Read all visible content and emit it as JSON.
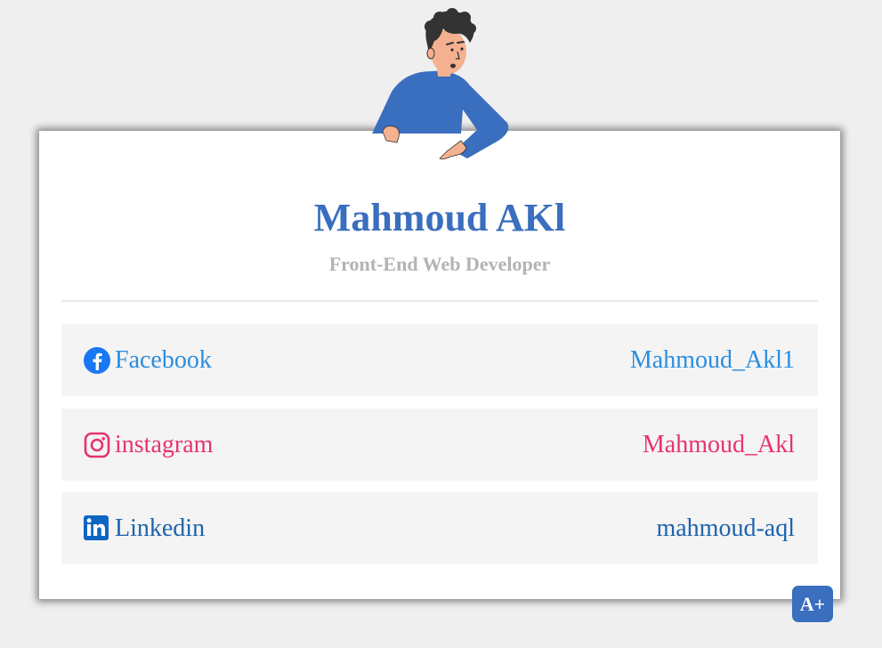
{
  "profile": {
    "name": "Mahmoud AKl",
    "title": "Front-End Web Developer"
  },
  "links": [
    {
      "platform": "Facebook",
      "handle": "Mahmoud_Akl1",
      "icon": "facebook-icon",
      "color": "#2a8ee0"
    },
    {
      "platform": "instagram",
      "handle": "Mahmoud_Akl",
      "icon": "instagram-icon",
      "color": "#e73370"
    },
    {
      "platform": "Linkedin",
      "handle": "mahmoud-aql",
      "icon": "linkedin-icon",
      "color": "#1e63ad"
    }
  ],
  "badge": {
    "label": "A+"
  },
  "colors": {
    "accent": "#3a6ebe",
    "background": "#efefef",
    "card": "#ffffff",
    "row": "#f4f4f4",
    "subtitle": "#b3b3b3"
  },
  "illustration": {
    "icon": "developer-character-illustration"
  }
}
